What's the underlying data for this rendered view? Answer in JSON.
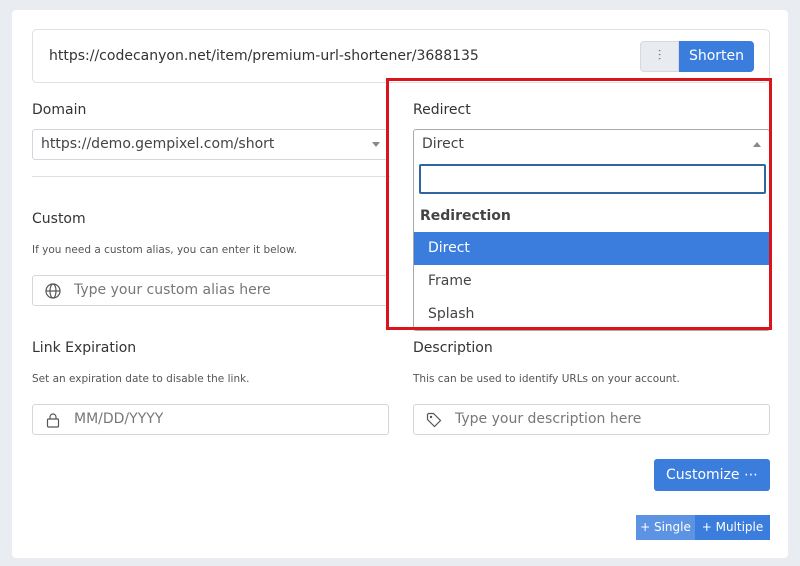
{
  "url_bar": {
    "value": "https://codecanyon.net/item/premium-url-shortener/3688135",
    "settings_icon": "sliders-icon",
    "shorten_label": "Shorten"
  },
  "domain": {
    "label": "Domain",
    "value": "https://demo.gempixel.com/short"
  },
  "redirect": {
    "label": "Redirect",
    "value": "Direct",
    "search_value": "",
    "group_label": "Redirection",
    "options": [
      {
        "label": "Direct",
        "selected": true
      },
      {
        "label": "Frame",
        "selected": false
      },
      {
        "label": "Splash",
        "selected": false
      }
    ]
  },
  "custom": {
    "label": "Custom",
    "help": "If you need a custom alias, you can enter it below.",
    "placeholder": "Type your custom alias here",
    "icon": "globe-icon"
  },
  "expiration": {
    "label": "Link Expiration",
    "help": "Set an expiration date to disable the link.",
    "placeholder": "MM/DD/YYYY",
    "icon": "lock-icon"
  },
  "description": {
    "label": "Description",
    "help": "This can be used to identify URLs on your account.",
    "placeholder": "Type your description here",
    "icon": "tag-icon"
  },
  "customize_label": "Customize ⋯",
  "single_label": "+ Single",
  "multiple_label": "+ Multiple",
  "colors": {
    "primary": "#3b7ddd",
    "highlight": "#d9141b"
  }
}
